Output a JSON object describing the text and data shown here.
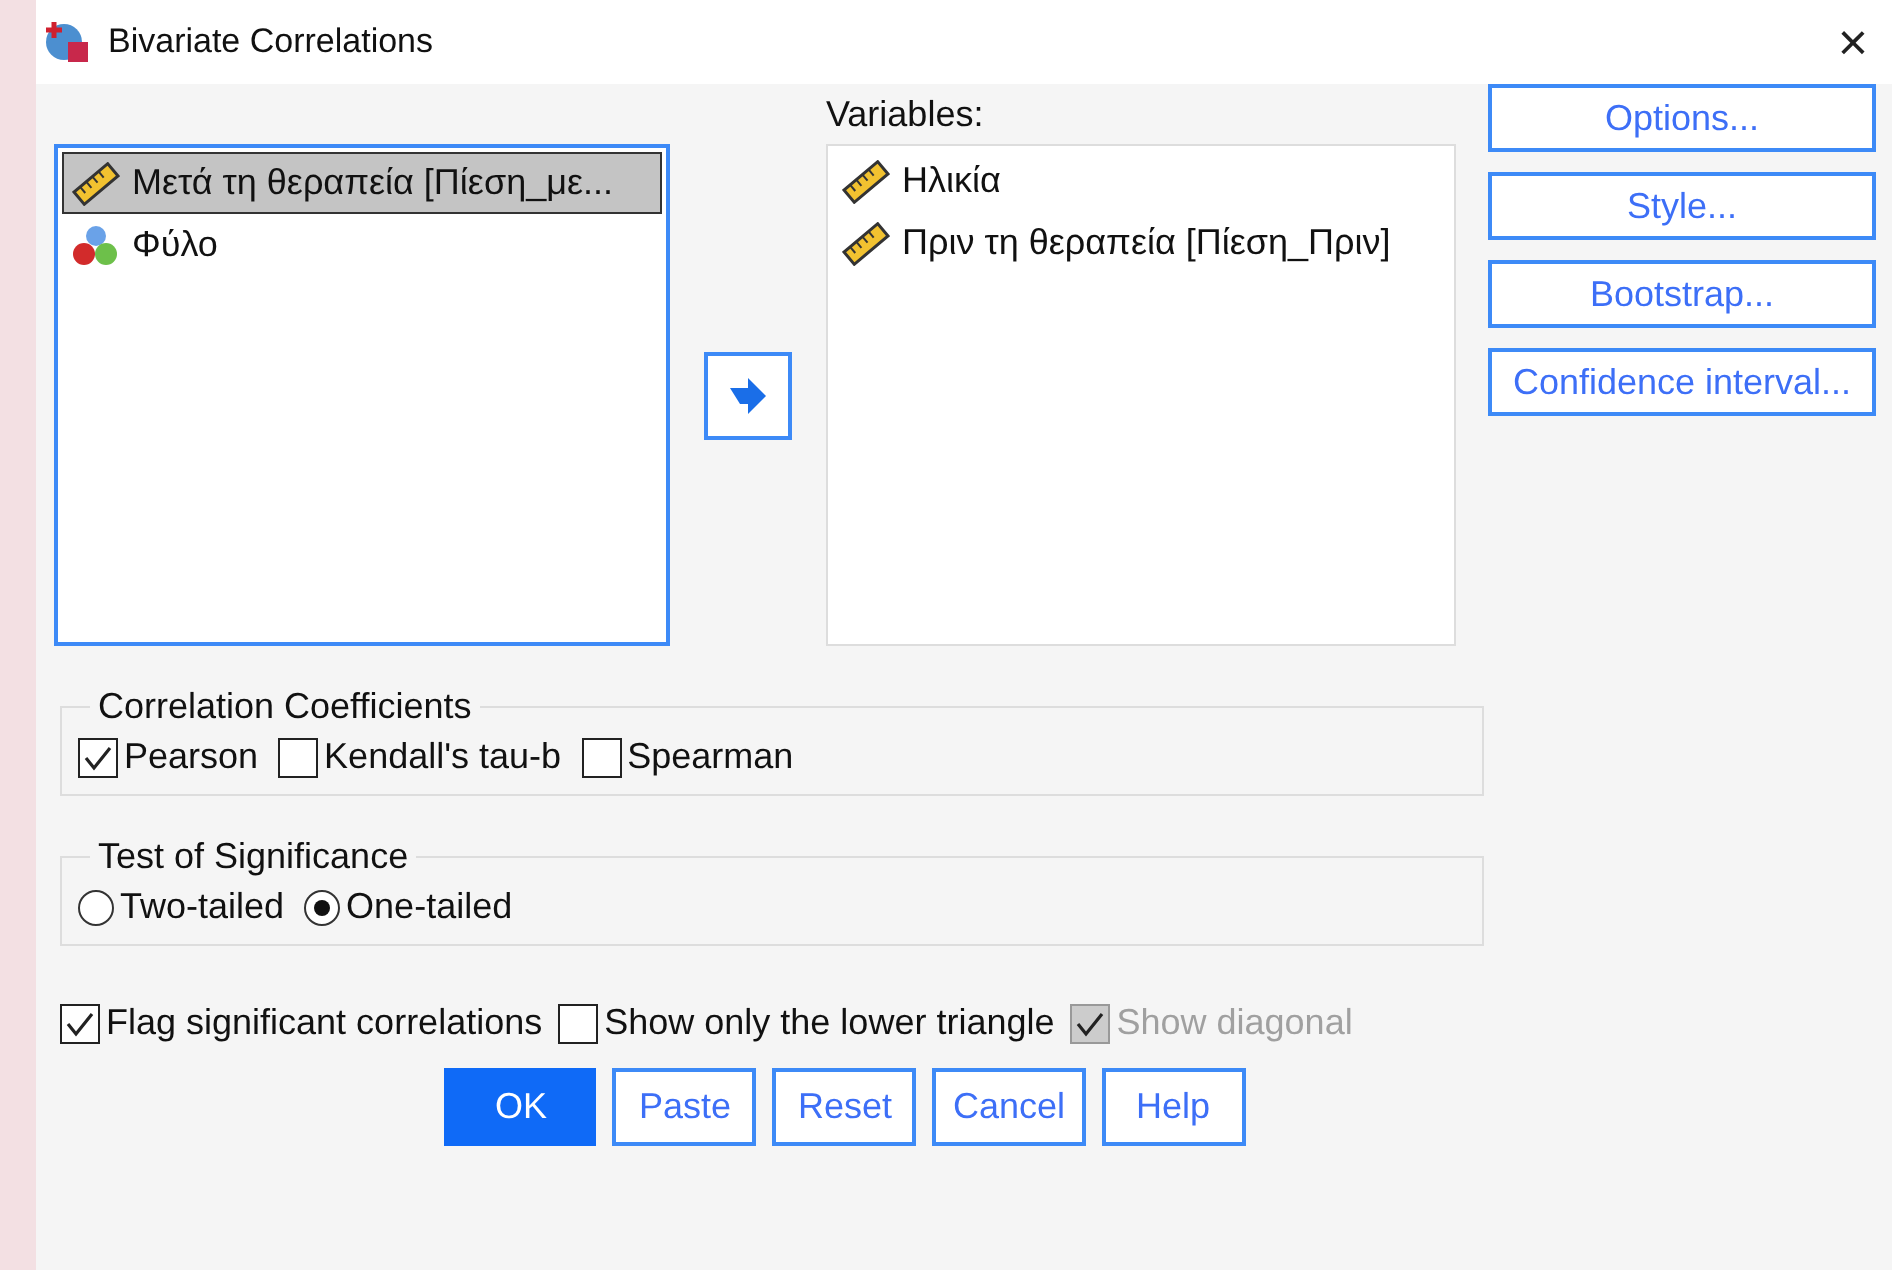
{
  "window": {
    "title": "Bivariate Correlations",
    "close": "×"
  },
  "source_list": {
    "items": [
      {
        "label": "Μετά τη θεραπεία [Πίεση_με...",
        "kind": "scale",
        "selected": true
      },
      {
        "label": "Φύλο",
        "kind": "nominal",
        "selected": false
      }
    ]
  },
  "variables": {
    "label": "Variables:",
    "items": [
      {
        "label": "Ηλικία",
        "kind": "scale",
        "selected": false
      },
      {
        "label": "Πριν τη θεραπεία [Πίεση_Πριν]",
        "kind": "scale",
        "selected": false
      }
    ]
  },
  "side_buttons": [
    "Options...",
    "Style...",
    "Bootstrap...",
    "Confidence interval..."
  ],
  "correlation_coefficients": {
    "title": "Correlation Coefficients",
    "options": [
      {
        "label": "Pearson",
        "checked": true
      },
      {
        "label": "Kendall's tau-b",
        "checked": false
      },
      {
        "label": "Spearman",
        "checked": false
      }
    ]
  },
  "test_of_significance": {
    "title": "Test of Significance",
    "options": [
      {
        "label": "Two-tailed",
        "selected": false
      },
      {
        "label": "One-tailed",
        "selected": true
      }
    ]
  },
  "flags": [
    {
      "label": "Flag significant correlations",
      "checked": true,
      "disabled": false
    },
    {
      "label": "Show only the lower triangle",
      "checked": false,
      "disabled": false
    },
    {
      "label": "Show diagonal",
      "checked": true,
      "disabled": true
    }
  ],
  "buttons": [
    {
      "label": "OK",
      "kind": "primary"
    },
    {
      "label": "Paste",
      "kind": "normal"
    },
    {
      "label": "Reset",
      "kind": "normal"
    },
    {
      "label": "Cancel",
      "kind": "normal"
    },
    {
      "label": "Help",
      "kind": "normal"
    }
  ]
}
